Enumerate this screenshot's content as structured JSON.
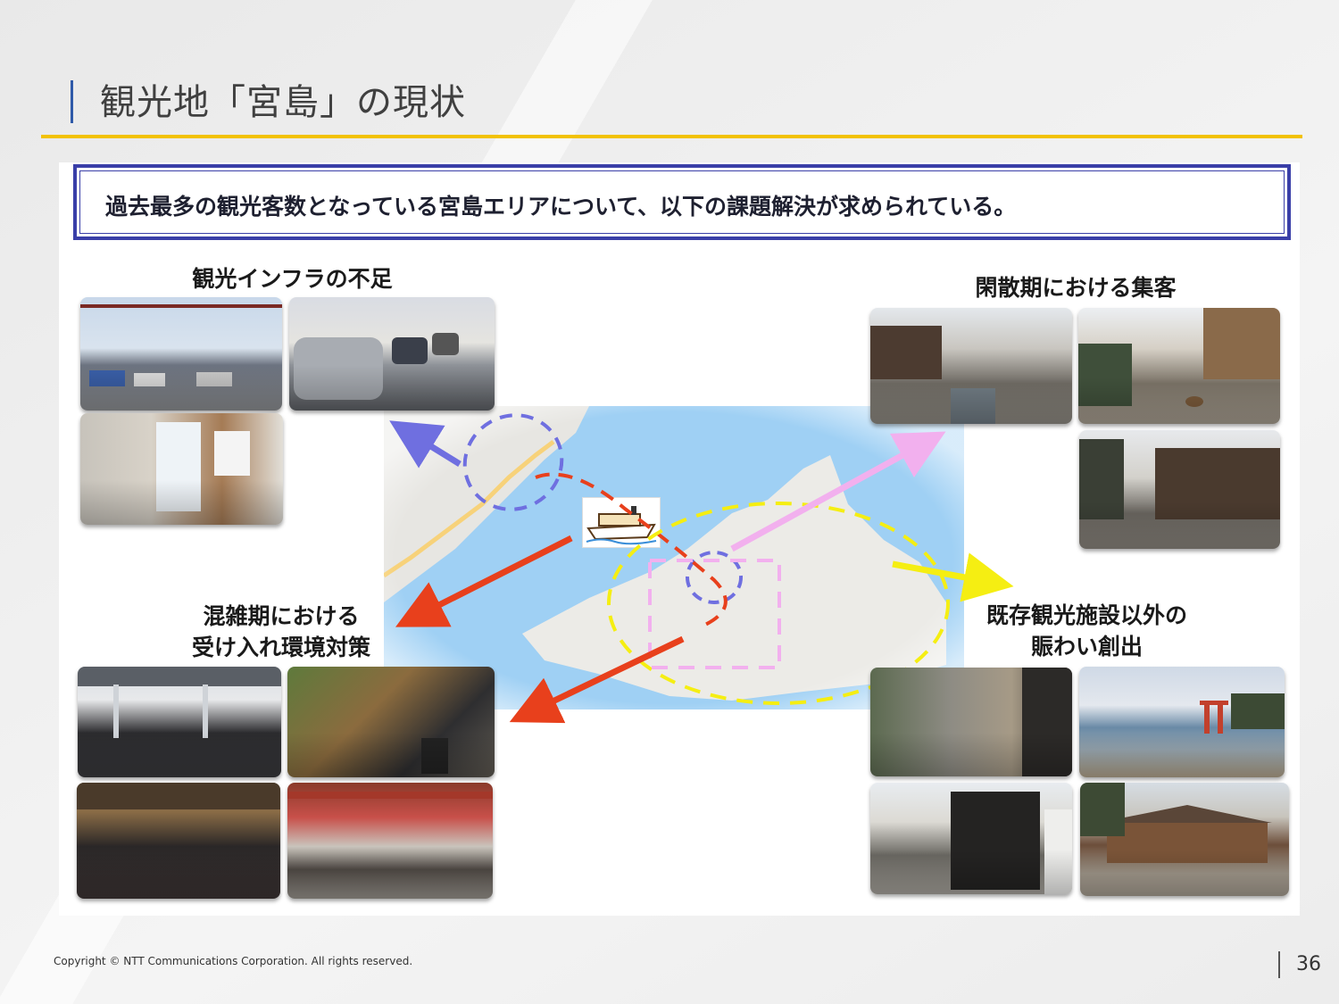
{
  "slide": {
    "title": "観光地「宮島」の現状",
    "banner": "過去最多の観光客数となっている宮島エリアについて、以下の課題解決が求められている。",
    "headings": {
      "infra": "観光インフラの不足",
      "offseason": "閑散期における集客",
      "crowded_line1": "混雑期における",
      "crowded_line2": "受け入れ環境対策",
      "new_spots_line1": "既存観光施設以外の",
      "new_spots_line2": "賑わい創出"
    },
    "colors": {
      "accent_yellow": "#f2c200",
      "banner_border": "#3a3fa8",
      "arrow_red": "#e8401c",
      "arrow_purple": "#6f6fe0",
      "arrow_pink": "#f2b0ee",
      "arrow_yellow": "#f5ee12"
    }
  },
  "footer": {
    "copyright": "Copyright © NTT Communications Corporation. All rights reserved.",
    "page_number": "36"
  }
}
